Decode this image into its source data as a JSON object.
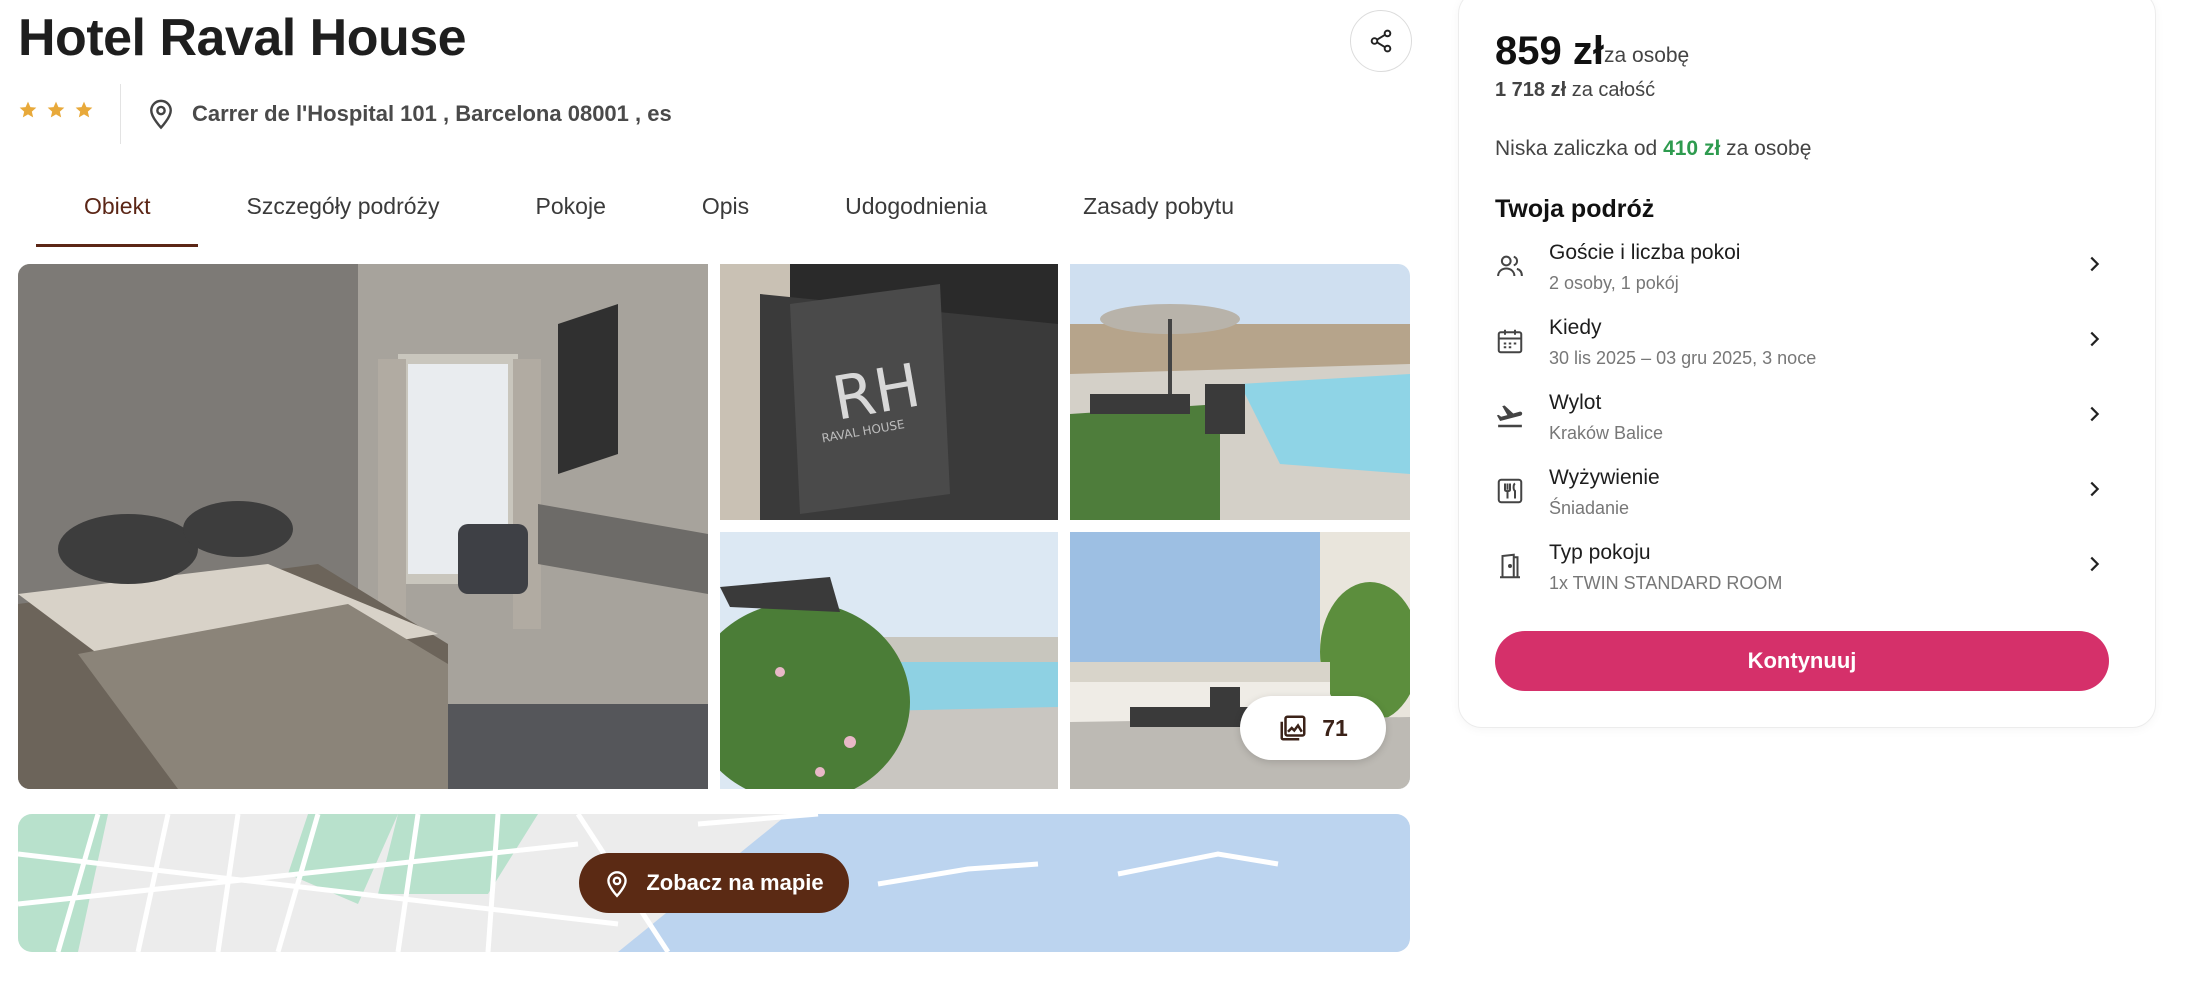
{
  "header": {
    "title": "Hotel Raval House",
    "stars": 3,
    "address": "Carrer de l'Hospital 101 , Barcelona 08001 , es"
  },
  "tabs": [
    {
      "label": "Obiekt",
      "active": true
    },
    {
      "label": "Szczegóły podróży",
      "active": false
    },
    {
      "label": "Pokoje",
      "active": false
    },
    {
      "label": "Opis",
      "active": false
    },
    {
      "label": "Udogodnienia",
      "active": false
    },
    {
      "label": "Zasady pobytu",
      "active": false
    }
  ],
  "gallery": {
    "photo_count": "71"
  },
  "map": {
    "button_label": "Zobacz na mapie"
  },
  "booking": {
    "price_per_person": "859 zł",
    "price_per_person_unit": "za osobę",
    "total_price": "1 718 zł",
    "total_unit": "za całość",
    "deposit_prefix": "Niska zaliczka od",
    "deposit_amount": "410 zł",
    "deposit_suffix": "za osobę",
    "trip_title": "Twoja podróż",
    "trip_items": [
      {
        "icon": "guests-icon",
        "label": "Goście i liczba pokoi",
        "value": "2 osoby, 1 pokój"
      },
      {
        "icon": "calendar-icon",
        "label": "Kiedy",
        "value": "30 lis 2025 – 03 gru 2025, 3 noce"
      },
      {
        "icon": "plane-departure-icon",
        "label": "Wylot",
        "value": "Kraków Balice"
      },
      {
        "icon": "meal-icon",
        "label": "Wyżywienie",
        "value": "Śniadanie"
      },
      {
        "icon": "door-icon",
        "label": "Typ pokoju",
        "value": "1x TWIN STANDARD ROOM"
      }
    ],
    "continue_label": "Kontynuuj"
  },
  "colors": {
    "brand_brown": "#5b2616",
    "continue_pink": "#d5306a",
    "deposit_green": "#2e9b4f",
    "star_gold": "#e8a93a"
  }
}
